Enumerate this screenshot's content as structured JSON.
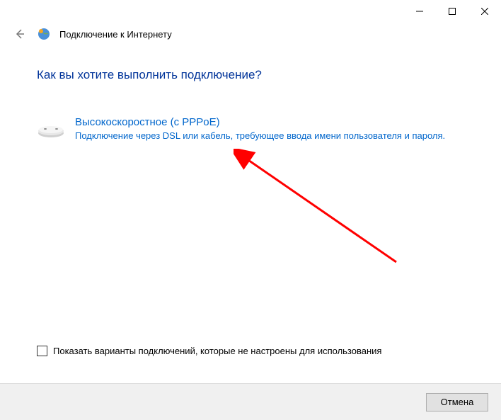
{
  "window": {
    "title": "Подключение к Интернету"
  },
  "main": {
    "question": "Как вы хотите выполнить подключение?",
    "option": {
      "title": "Высокоскоростное (с PPPoE)",
      "description": "Подключение через DSL или кабель, требующее ввода имени пользователя и пароля."
    },
    "show_unconfigured_label": "Показать варианты подключений, которые не настроены для использования"
  },
  "footer": {
    "cancel": "Отмена"
  }
}
